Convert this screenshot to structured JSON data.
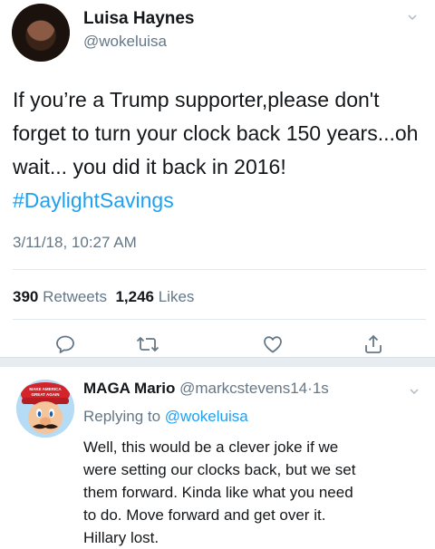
{
  "tweet": {
    "display_name": "Luisa Haynes",
    "handle": "@wokeluisa",
    "text": "If you’re a Trump supporter,please don't forget to turn your clock back 150 years...oh wait... you did it back in 2016! ",
    "hashtag": "#DaylightSavings",
    "timestamp": "3/11/18, 10:27 AM",
    "retweets_count": "390",
    "retweets_label": "Retweets",
    "likes_count": "1,246",
    "likes_label": "Likes",
    "icons": [
      "reply-icon",
      "retweet-icon",
      "like-icon",
      "share-icon",
      "chevron-down-icon"
    ],
    "colors": {
      "link": "#1da1f2",
      "secondary": "#657786",
      "primary": "#14171a"
    }
  },
  "reply": {
    "display_name": "MAGA Mario",
    "handle": "@markcstevens14",
    "separator": "·",
    "age": "1s",
    "replying_label": "Replying to",
    "replying_to": "@wokeluisa",
    "text": "Well, this would be a clever joke if we\nwere setting our clocks back, but we set\nthem forward.  Kinda like what you need\nto do.  Move forward and get over it.\nHillary lost.",
    "hat_text": "MAKE AMERICA GREAT AGAIN"
  }
}
